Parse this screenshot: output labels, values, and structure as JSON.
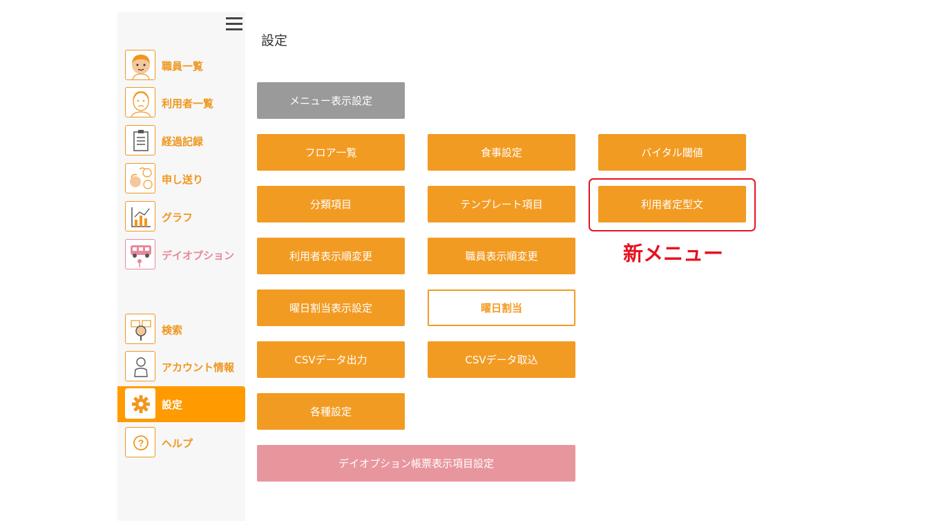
{
  "sidebar": {
    "items": [
      {
        "label": "職員一覧",
        "icon": "staff-face-icon"
      },
      {
        "label": "利用者一覧",
        "icon": "elder-face-icon"
      },
      {
        "label": "経過記録",
        "icon": "clipboard-icon"
      },
      {
        "label": "申し送り",
        "icon": "handover-people-icon"
      },
      {
        "label": "グラフ",
        "icon": "bar-chart-icon"
      },
      {
        "label": "デイオプション",
        "icon": "van-icon"
      },
      {
        "label": "検索",
        "icon": "search-magnifier-icon"
      },
      {
        "label": "アカウント情報",
        "icon": "person-icon"
      },
      {
        "label": "設定",
        "icon": "gear-icon"
      },
      {
        "label": "ヘルプ",
        "icon": "help-icon"
      }
    ],
    "active_item": "設定",
    "colors": {
      "accent": "#f0961e",
      "active_bg": "#ff9a00",
      "pink": "#e8889a"
    }
  },
  "page": {
    "title": "設定"
  },
  "buttons": {
    "menu_display": "メニュー表示設定",
    "floor_list": "フロア一覧",
    "meal_settings": "食事設定",
    "vital_threshold": "バイタル閾値",
    "category_items": "分類項目",
    "template_items": "テンプレート項目",
    "user_fixed_text": "利用者定型文",
    "user_order": "利用者表示順変更",
    "staff_order": "職員表示順変更",
    "weekday_display": "曜日割当表示設定",
    "weekday_assign": "曜日割当",
    "csv_export": "CSVデータ出力",
    "csv_import": "CSVデータ取込",
    "misc_settings": "各種設定",
    "dayoption_report": "デイオプション帳票表示項目設定"
  },
  "annotation": {
    "new_menu": "新メニュー",
    "color": "#e8111f"
  },
  "colors": {
    "button_orange": "#f29b22",
    "button_gray": "#9a9a9a",
    "button_pink": "#e8969e"
  }
}
